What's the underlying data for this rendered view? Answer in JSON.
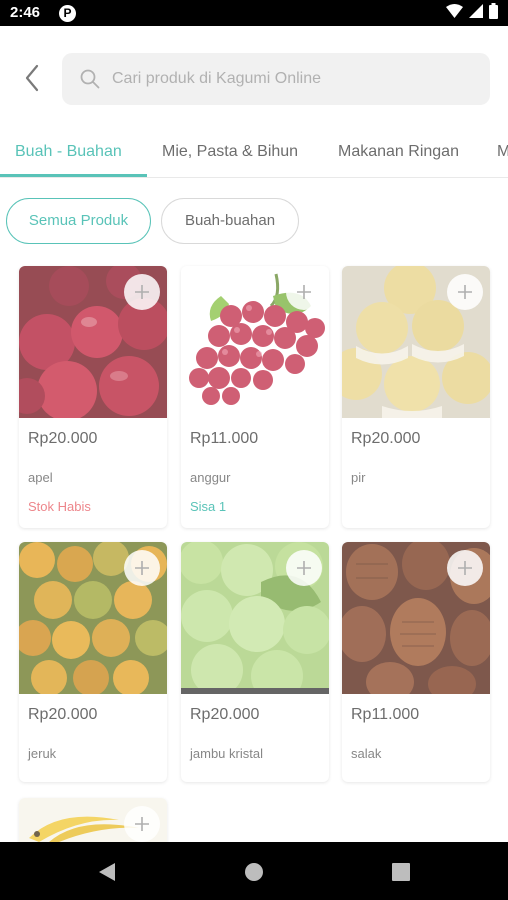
{
  "status_bar": {
    "time": "2:46",
    "app_badge": "P",
    "icons": [
      "wifi-icon",
      "signal-icon",
      "battery-icon"
    ]
  },
  "header": {
    "back_icon": "back-arrow-icon",
    "search": {
      "icon": "search-icon",
      "placeholder": "Cari produk di Kagumi Online"
    }
  },
  "tabs": [
    {
      "label": "Buah - Buahan",
      "active": true
    },
    {
      "label": "Mie, Pasta & Bihun",
      "active": false
    },
    {
      "label": "Makanan Ringan",
      "active": false
    },
    {
      "label": "M",
      "active": false
    }
  ],
  "filters": [
    {
      "label": "Semua Produk",
      "active": true
    },
    {
      "label": "Buah-buahan",
      "active": false
    }
  ],
  "products": [
    {
      "price": "Rp20.000",
      "name": "apel",
      "stock": "Stok Habis",
      "stock_color": "#e8646b",
      "image": "apple-image"
    },
    {
      "price": "Rp11.000",
      "name": "anggur",
      "stock": "Sisa 1",
      "stock_color": "#2bb3a4",
      "image": "grapes-image"
    },
    {
      "price": "Rp20.000",
      "name": "pir",
      "stock": "",
      "image": "pear-image"
    },
    {
      "price": "Rp20.000",
      "name": "jeruk",
      "stock": "",
      "image": "orange-image"
    },
    {
      "price": "Rp20.000",
      "name": "jambu kristal",
      "stock": "",
      "image": "guava-image"
    },
    {
      "price": "Rp11.000",
      "name": "salak",
      "stock": "",
      "image": "salak-image"
    },
    {
      "price": "",
      "name": "",
      "stock": "",
      "image": "banana-image"
    }
  ],
  "add_button_icon": "plus-icon",
  "colors": {
    "accent": "#2bb3a4",
    "out_of_stock": "#e8646b",
    "search_bg": "#eeeeee"
  },
  "nav_bar": {
    "back": "nav-back-icon",
    "home": "nav-home-icon",
    "recents": "nav-recents-icon"
  }
}
